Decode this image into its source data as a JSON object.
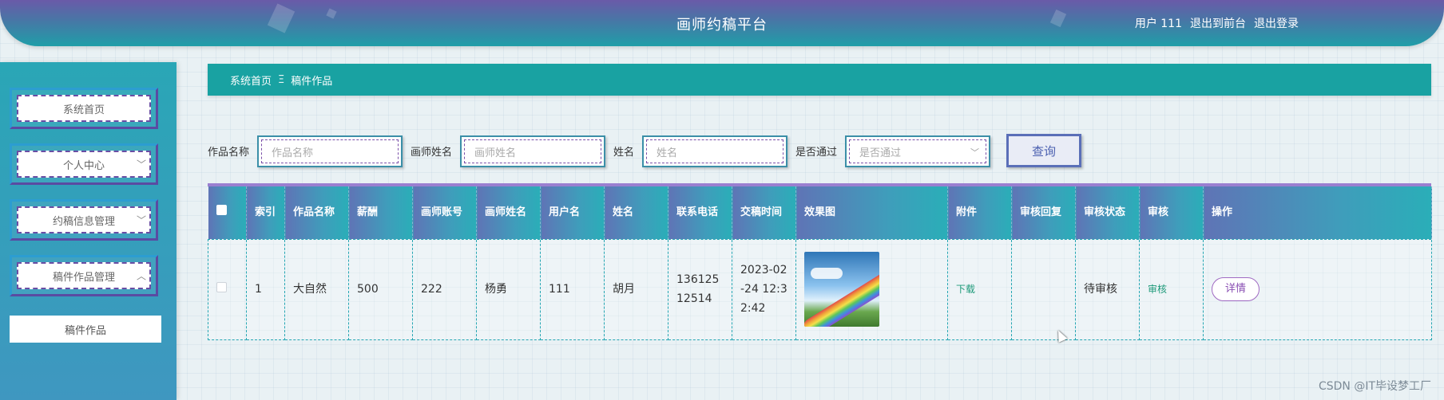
{
  "header": {
    "title": "画师约稿平台",
    "user": "用户 111",
    "back_front": "退出到前台",
    "logout": "退出登录"
  },
  "sidebar": {
    "items": [
      {
        "label": "系统首页",
        "expandable": false
      },
      {
        "label": "个人中心",
        "expandable": true,
        "chevron": "﹀"
      },
      {
        "label": "约稿信息管理",
        "expandable": true,
        "chevron": "﹀"
      },
      {
        "label": "稿件作品管理",
        "expandable": true,
        "chevron": "︿"
      }
    ],
    "sub_items": [
      {
        "label": "稿件作品"
      }
    ]
  },
  "breadcrumb": {
    "home": "系统首页",
    "separator": "Ξ",
    "current": "稿件作品"
  },
  "search": {
    "work_name_label": "作品名称",
    "work_name_placeholder": "作品名称",
    "artist_name_label": "画师姓名",
    "artist_name_placeholder": "画师姓名",
    "name_label": "姓名",
    "name_placeholder": "姓名",
    "passed_label": "是否通过",
    "passed_placeholder": "是否通过",
    "passed_chevron": "﹀",
    "query_button": "查询"
  },
  "table": {
    "headers": [
      "索引",
      "作品名称",
      "薪酬",
      "画师账号",
      "画师姓名",
      "用户名",
      "姓名",
      "联系电话",
      "交稿时间",
      "效果图",
      "附件",
      "审核回复",
      "审核状态",
      "审核",
      "操作"
    ],
    "rows": [
      {
        "index": "1",
        "work_name": "大自然",
        "salary": "500",
        "artist_account": "222",
        "artist_name": "杨勇",
        "username": "111",
        "name": "胡月",
        "phone": "13612512514",
        "submit_time": "2023-02-24 12:32:42",
        "image_icon": "landscape-rainbow-image",
        "attachment": "下载",
        "review_reply": "",
        "review_status": "待审核",
        "review_action": "审核",
        "operation": "详情"
      }
    ]
  },
  "watermark": "CSDN @IT毕设梦工厂"
}
